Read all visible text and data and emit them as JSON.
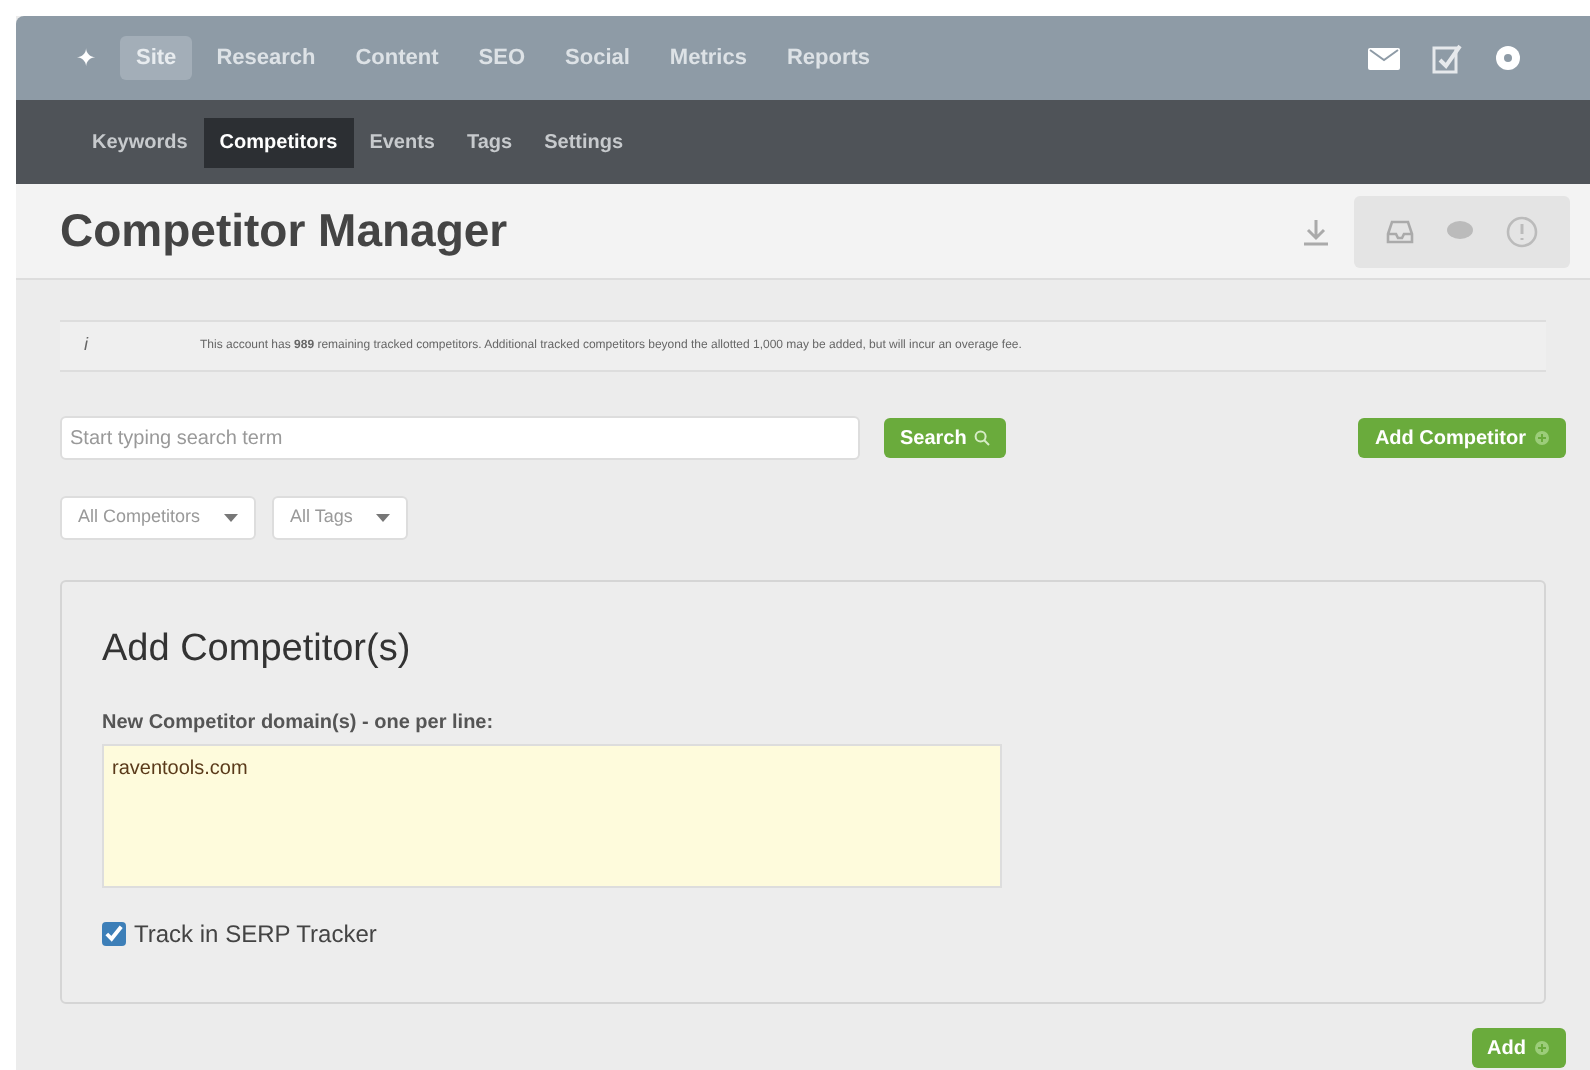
{
  "top_nav": {
    "home_icon": "✦",
    "items": [
      {
        "label": "Site",
        "selected": true
      },
      {
        "label": "Research",
        "selected": false
      },
      {
        "label": "Content",
        "selected": false
      },
      {
        "label": "SEO",
        "selected": false
      },
      {
        "label": "Social",
        "selected": false
      },
      {
        "label": "Metrics",
        "selected": false
      },
      {
        "label": "Reports",
        "selected": false
      }
    ]
  },
  "sub_nav": {
    "items": [
      {
        "label": "Keywords",
        "selected": false
      },
      {
        "label": "Competitors",
        "selected": true
      },
      {
        "label": "Events",
        "selected": false
      },
      {
        "label": "Tags",
        "selected": false
      },
      {
        "label": "Settings",
        "selected": false
      }
    ]
  },
  "page_title": "Competitor Manager",
  "notice": {
    "icon": "i",
    "text": "This account has **989** remaining tracked competitors. Additional tracked competitors beyond the allotted 1,000 may be added, but will incur an overage fee."
  },
  "search": {
    "placeholder": "Start typing search term",
    "button": "Search"
  },
  "add_competitor_button": "Add Competitor",
  "filters": [
    "All Competitors",
    "All Tags"
  ],
  "add_panel": {
    "title": "Add Competitor(s)",
    "field_label": "New Competitor domain(s) - one per line:",
    "value": "raventools.com",
    "track_serp": {
      "label": "Track in SERP Tracker",
      "checked": true
    }
  },
  "add_button": "Add"
}
